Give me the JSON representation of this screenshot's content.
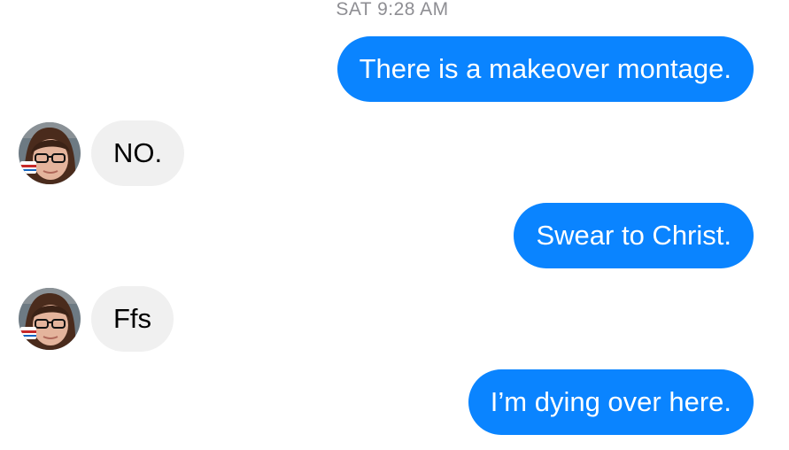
{
  "conversation": {
    "timestamp": "SAT 9:28 AM",
    "messages": [
      {
        "direction": "outgoing",
        "text": "There is a makeover montage."
      },
      {
        "direction": "incoming",
        "text": "NO.",
        "avatar": "contact-avatar-photo"
      },
      {
        "direction": "outgoing",
        "text": "Swear to Christ."
      },
      {
        "direction": "incoming",
        "text": "Ffs",
        "avatar": "contact-avatar-photo"
      },
      {
        "direction": "outgoing",
        "text": "I’m dying over here."
      }
    ]
  },
  "colors": {
    "outgoing_bubble": "#0a84ff",
    "incoming_bubble": "#f0f0f0",
    "timestamp_text": "#8e8e93"
  }
}
